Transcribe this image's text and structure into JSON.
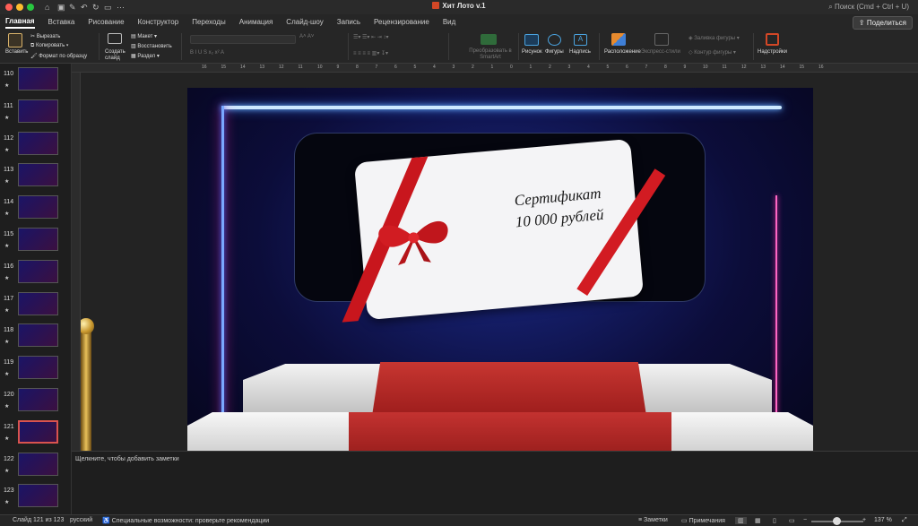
{
  "window": {
    "title": "Хит Лото v.1",
    "search_placeholder": "Поиск (Cmd + Ctrl + U)"
  },
  "tabs": [
    "Главная",
    "Вставка",
    "Рисование",
    "Конструктор",
    "Переходы",
    "Анимация",
    "Слайд-шоу",
    "Запись",
    "Рецензирование",
    "Вид"
  ],
  "share_label": "Поделиться",
  "ribbon": {
    "paste": "Вставить",
    "cut": "Вырезать",
    "copy": "Копировать",
    "format_painter": "Формат по образцу",
    "new_slide": "Создать слайд",
    "layout": "Макет",
    "reset": "Восстановить",
    "section": "Раздел",
    "smartart": "Преобразовать в SmartArt",
    "picture": "Рисунок",
    "shapes": "Фигуры",
    "textbox": "Надпись",
    "arrange": "Расположение",
    "quick_styles": "Экспресс-стили",
    "shape_fill": "Заливка фигуры",
    "shape_outline": "Контур фигуры",
    "addins": "Надстройки"
  },
  "ruler_labels": [
    "16",
    "15",
    "14",
    "13",
    "12",
    "11",
    "10",
    "9",
    "8",
    "7",
    "6",
    "5",
    "4",
    "3",
    "2",
    "1",
    "0",
    "1",
    "2",
    "3",
    "4",
    "5",
    "6",
    "7",
    "8",
    "9",
    "10",
    "11",
    "12",
    "13",
    "14",
    "15",
    "16"
  ],
  "thumbnails": [
    "110",
    "111",
    "112",
    "113",
    "114",
    "115",
    "116",
    "117",
    "118",
    "119",
    "120",
    "121",
    "122",
    "123"
  ],
  "thumb_star": "★",
  "selected_thumb": "121",
  "slide": {
    "card_line1": "Сертификат",
    "card_line2": "10 000 рублей"
  },
  "notes_placeholder": "Щелкните, чтобы добавить заметки",
  "status": {
    "slide_of": "Слайд 121 из 123",
    "language": "русский",
    "accessibility": "Специальные возможности: проверьте рекомендации",
    "notes": "Заметки",
    "comments": "Примечания",
    "zoom": "137 %"
  },
  "colors": {
    "accent_red": "#c8161d",
    "selected_border": "#d9534f",
    "ppt_icon": "#d24726"
  }
}
